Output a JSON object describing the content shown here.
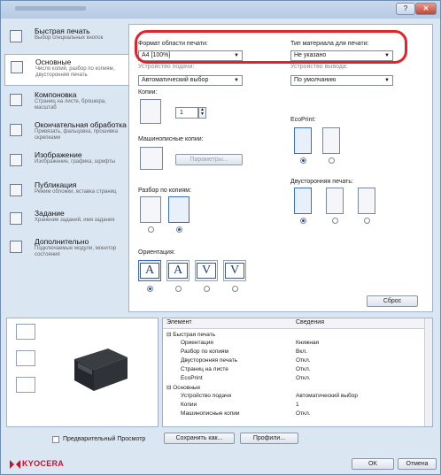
{
  "nav": [
    {
      "title": "Быстрая печать",
      "sub": "Выбор специальных кнопок"
    },
    {
      "title": "Основные",
      "sub": "Число копий, разбор по копиям, двусторонняя печать"
    },
    {
      "title": "Компоновка",
      "sub": "Страниц на листе, брошюра, масштаб"
    },
    {
      "title": "Окончательная обработка",
      "sub": "Привязать, фальцовка, прошивка скрепками"
    },
    {
      "title": "Изображение",
      "sub": "Изображение, графика, шрифты"
    },
    {
      "title": "Публикация",
      "sub": "Режим обложки, вставка страниц"
    },
    {
      "title": "Задание",
      "sub": "Хранение заданий, имя задания"
    },
    {
      "title": "Дополнительно",
      "sub": "Подключаемые модули, монитор состояния"
    }
  ],
  "basic": {
    "format_label": "Формат области печати:",
    "format_value": "A4 [100%]",
    "media_label": "Тип материала для печати:",
    "media_value": "Не указано",
    "source_label": "Устройство подачи:",
    "source_value": "Автоматический выбор",
    "dest_label": "Устройство вывода:",
    "dest_value": "По умолчанию",
    "copies_label": "Копии:",
    "copies_value": "1",
    "ecoprint_label": "EcoPrint:",
    "mach_copies_label": "Машинописные копии:",
    "params_button": "Параметры...",
    "collate_label": "Разбор по копиям:",
    "duplex_label": "Двусторонняя печать:",
    "orientation_label": "Ориентация:",
    "orientation_glyphs": [
      "A",
      "A",
      "V",
      "V"
    ],
    "reset_button": "Сброс"
  },
  "grid": {
    "col_element": "Элемент",
    "col_info": "Сведения",
    "rows": [
      {
        "k": "⊟ Быстрая печать",
        "v": ""
      },
      {
        "k": "Ориентация",
        "v": "Книжная"
      },
      {
        "k": "Разбор по копиям",
        "v": "Вкл."
      },
      {
        "k": "Двусторонняя печать",
        "v": "Откл."
      },
      {
        "k": "Страниц на листе",
        "v": "Откл."
      },
      {
        "k": "EcoPrint",
        "v": "Откл."
      },
      {
        "k": "⊟ Основные",
        "v": ""
      },
      {
        "k": "Устройство подачи",
        "v": "Автоматический выбор"
      },
      {
        "k": "Копии",
        "v": "1"
      },
      {
        "k": "Машинописные копии",
        "v": "Откл."
      }
    ]
  },
  "footer": {
    "preview_checkbox": "Предварительный Просмотр",
    "save_as_button": "Сохранить как...",
    "profiles_button": "Профили...",
    "ok_button": "OK",
    "cancel_button": "Отмена",
    "brand": "KYOCERA"
  },
  "colors": {
    "highlight": "#e0242a",
    "brand": "#c8102e",
    "selection": "#3a6fbf"
  }
}
